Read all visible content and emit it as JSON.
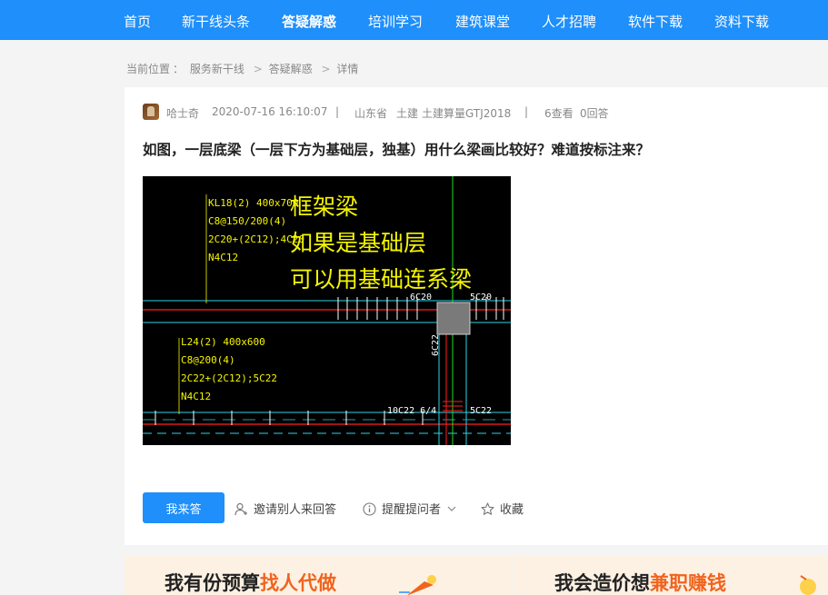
{
  "nav": {
    "items": [
      "首页",
      "新干线头条",
      "答疑解惑",
      "培训学习",
      "建筑课堂",
      "人才招聘",
      "软件下载",
      "资料下载"
    ],
    "active": "答疑解惑"
  },
  "breadcrumb": [
    "当前位置",
    "：",
    "服务新干线",
    ">",
    "答疑解惑",
    ">",
    "详情"
  ],
  "question": {
    "user": "哈士奇",
    "datetime": "2020-07-16 16:10:07",
    "divider": "|",
    "province": "山东省",
    "category": "土建",
    "software": "土建算量GTJ2018",
    "views": "6查看",
    "answers": "0回答",
    "title": "如图，一层底梁（一层下方为基础层，独基）用什么梁画比较好？难道按标注来？"
  },
  "cad": {
    "beam1": [
      "KL18(2) 400x700",
      "C8@150/200(4)",
      "2C20+(2C12);4C20",
      "N4C12"
    ],
    "beam2": [
      "L24(2) 400x600",
      "C8@200(4)",
      "2C22+(2C12);5C22",
      "N4C12"
    ],
    "annotations": [
      "框架梁",
      "如果是基础层",
      "可以用基础连系梁"
    ],
    "labels": [
      "6C20",
      "5C20",
      "6C22",
      "10C22 6/4",
      "5C22"
    ]
  },
  "actions": {
    "answer": "我来答",
    "invite": "邀请别人来回答",
    "remind": "提醒提问者",
    "favorite": "收藏"
  },
  "banners": {
    "left_main": "我有份预算",
    "left_highlight": "找人代做",
    "right_main": "我会造价想",
    "right_highlight": "兼职赚钱"
  },
  "colors": {
    "primary": "#1e8ffb",
    "highlight": "#f0641e",
    "cad_yellow": "#f5f500"
  }
}
